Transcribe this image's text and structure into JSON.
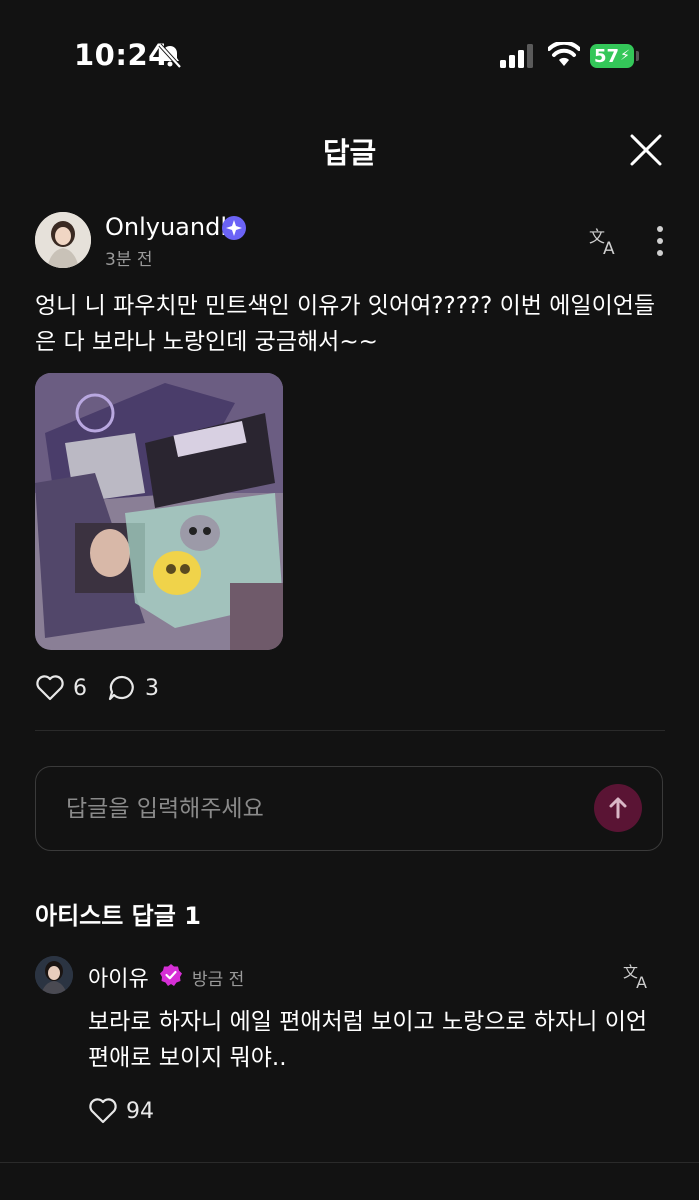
{
  "status_bar": {
    "time": "10:24",
    "battery": "57"
  },
  "header": {
    "title": "답글"
  },
  "post": {
    "author": "Onlyuandl",
    "time": "3분 전",
    "text": "엉니 니 파우치만 민트색인 이유가 잇어여????? 이번 에일이언들은 다 보라나 노랑인데 궁금해서~~",
    "likes": "6",
    "comments": "3"
  },
  "reply_input": {
    "placeholder": "답글을 입력해주세요"
  },
  "artist_section": {
    "heading": "아티스트 답글 1"
  },
  "artist_reply": {
    "author": "아이유",
    "time": "방금 전",
    "text": "보라로 하자니 에일 편애처럼 보이고 노랑으로 하자니 이언 편애로 보이지 뭐야..",
    "likes": "94"
  },
  "colors": {
    "background": "#121212",
    "send_button": "#5a1434",
    "verified_badge": "#6b63f6",
    "artist_badge": "#d62fd6"
  }
}
